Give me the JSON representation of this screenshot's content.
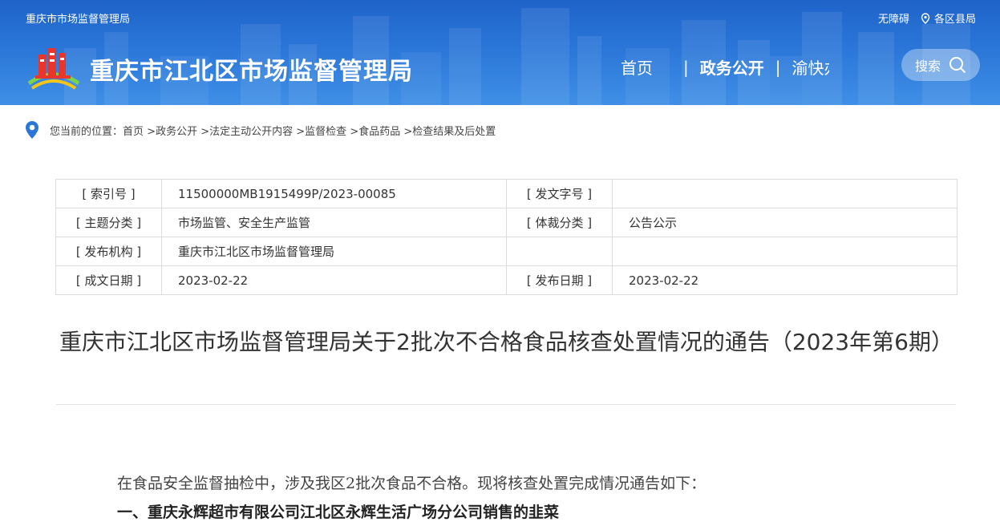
{
  "header": {
    "top_left": "重庆市市场监督管理局",
    "accessibility": "无障碍",
    "districts": "各区县局",
    "site_title": "重庆市江北区市场监督管理局",
    "nav": {
      "home": "首页",
      "gov_open": "政务公开",
      "yukuaiban": "渝快办"
    },
    "search_label": "搜索",
    "colors": {
      "primary": "#2a76d8"
    }
  },
  "breadcrumb": {
    "prefix": "您当前的位置：",
    "items": [
      "首页",
      ">政务公开",
      ">法定主动公开内容",
      ">监督检查",
      ">食品药品",
      ">检查结果及后处置"
    ]
  },
  "meta": {
    "rows": [
      {
        "l1": "[ 索引号 ]",
        "v1": "11500000MB1915499P/2023-00085",
        "l2": "[ 发文字号 ]",
        "v2": ""
      },
      {
        "l1": "[ 主题分类 ]",
        "v1": "市场监管、安全生产监管",
        "l2": "[ 体裁分类 ]",
        "v2": "公告公示"
      },
      {
        "l1": "[ 发布机构 ]",
        "v1": "重庆市江北区市场监督管理局",
        "l2": "",
        "v2": ""
      },
      {
        "l1": "[ 成文日期 ]",
        "v1": "2023-02-22",
        "l2": "[ 发布日期 ]",
        "v2": "2023-02-22"
      }
    ]
  },
  "article": {
    "title": "重庆市江北区市场监督管理局关于2批次不合格食品核查处置情况的通告（2023年第6期）",
    "intro": "在食品安全监督抽检中，涉及我区2批次食品不合格。现将核查处置完成情况通告如下：",
    "section1": "一、重庆永辉超市有限公司江北区永辉生活广场分公司销售的韭菜"
  }
}
